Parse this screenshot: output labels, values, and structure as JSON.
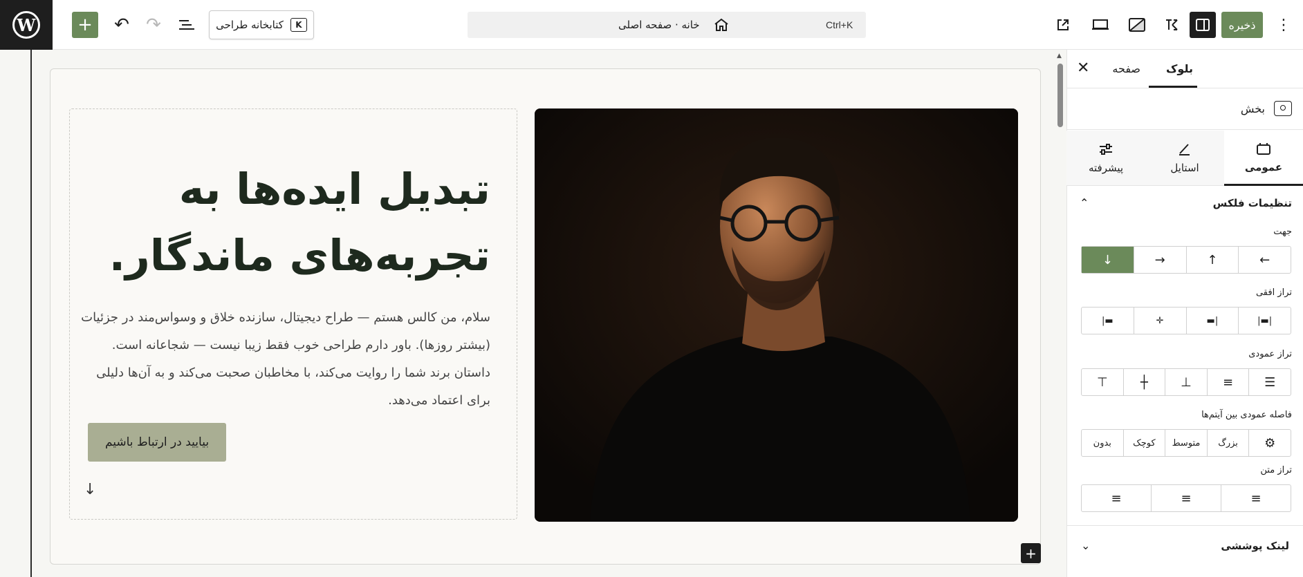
{
  "topbar": {
    "logo": "W",
    "add_label": "+",
    "undo_label": "↶",
    "redo_label": "↷",
    "pattern_library_label": "کتابخانه طراحی",
    "pattern_icon_glyph": "K",
    "command": {
      "shortcut": "Ctrl+K",
      "title": "خانه · صفحه اصلی"
    },
    "save_label": "ذخیره",
    "more_label": "⋮",
    "accent_color": "#6b8a5a"
  },
  "hero": {
    "title_line1": "تبدیل ایده‌ها به",
    "title_line2": "تجربه‌های ماندگار.",
    "description": "سلام، من کالس هستم — طراح دیجیتال، سازنده خلاق و وسواس‌مند در جزئیات (بیشتر روزها). باور دارم طراحی خوب فقط زیبا نیست — شجاعانه است. داستان برند شما را روایت می‌کند، با مخاطبان صحبت می‌کند و به آن‌ها دلیلی برای اعتماد می‌دهد.",
    "cta_label": "بیایید در ارتباط باشیم",
    "down_arrow": "↓",
    "cta_color": "#a9ae93"
  },
  "canvas": {
    "block_add_label": "+"
  },
  "sidebar": {
    "close_label": "✕",
    "tabs": {
      "page": "صفحه",
      "block": "بلوک"
    },
    "block_name": "بخش",
    "sub_tabs": {
      "general": "عمومی",
      "style": "استایل",
      "advanced": "پیشرفته"
    },
    "flex_section_title": "تنظیمات فلکس",
    "direction_label": "جهت",
    "direction_options": [
      "↓",
      "→",
      "↑",
      "←"
    ],
    "justify_label": "تراز افقی",
    "justify_options": [
      "|▬",
      "✛",
      "▬|",
      "|▬|"
    ],
    "vertical_align_label": "تراز عمودی",
    "vertical_options": [
      "⊤",
      "┼",
      "⊥",
      "≡",
      "☰"
    ],
    "gap_label": "فاصله عمودی بین آیتم‌ها",
    "gap_options": [
      "بدون",
      "کوچک",
      "متوسط",
      "بزرگ"
    ],
    "gap_custom_icon": "⚙",
    "text_align_label": "تراز متن",
    "text_align_options": [
      "≡",
      "≡",
      "≡"
    ],
    "link_section_title": "لینک پوششی",
    "chevron_up": "⌃",
    "chevron_down": "⌄"
  }
}
